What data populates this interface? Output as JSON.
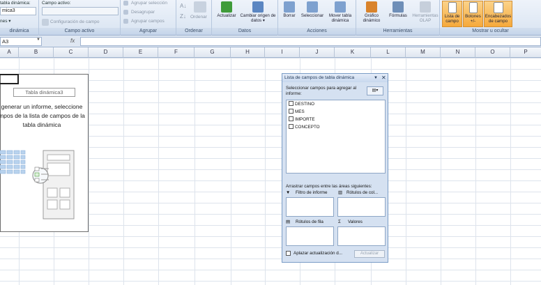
{
  "ribbon": {
    "group1": {
      "name_label": "tabla dinámica:",
      "name_value": "mica3",
      "options_label": "nes ▾",
      "group_label": "dinámica"
    },
    "group2": {
      "active_field_label": "Campo activo:",
      "field_config": "Configuración de campo",
      "group_label": "Campo activo"
    },
    "group3": {
      "group_selection": "Agrupar selección",
      "ungroup": "Desagrupar",
      "group_fields": "Agrupar campos",
      "group_label": "Agrupar"
    },
    "group4": {
      "az": "A↓",
      "za": "Z↓",
      "sort": "Ordenar",
      "group_label": "Ordenar"
    },
    "group5": {
      "refresh": "Actualizar",
      "change_source": "Cambiar origen de datos ▾",
      "group_label": "Datos"
    },
    "group6": {
      "delete": "Borrar",
      "select": "Seleccionar",
      "move": "Mover tabla dinámica",
      "group_label": "Acciones"
    },
    "group7": {
      "chart": "Gráfico dinámico",
      "formulas": "Fórmulas",
      "olap": "Herramientas OLAP",
      "group_label": "Herramientas"
    },
    "group8": {
      "field_list": "Lista de campo",
      "buttons": "Botones +/-",
      "headers": "Encabezados de campo",
      "group_label": "Mostrar u ocultar"
    }
  },
  "formula_bar": {
    "name_box": "A3",
    "fx": "fx"
  },
  "columns": [
    "A",
    "B",
    "C",
    "D",
    "E",
    "F",
    "G",
    "H",
    "I",
    "J",
    "K",
    "L",
    "M",
    "N",
    "O",
    "P"
  ],
  "pivot_placeholder": {
    "title": "Tabla dinámica3",
    "message_lines": [
      "generar un informe, seleccione",
      "mpos de la lista de campos de la",
      "tabla dinámica"
    ]
  },
  "field_pane": {
    "title": "Lista de campos de tabla dinámica",
    "select_label": "Seleccionar campos para agregar al informe:",
    "fields": [
      "DESTINO",
      "MES",
      "IMPORTE",
      "CONCEPTO"
    ],
    "drag_label": "Arrastrar campos entre las áreas siguientes:",
    "zones": {
      "report_filter": "Filtro de informe",
      "column_labels": "Rótulos de col...",
      "row_labels": "Rótulos de fila",
      "values": "Valores"
    },
    "defer_label": "Aplazar actualización d...",
    "update_button": "Actualizar"
  }
}
